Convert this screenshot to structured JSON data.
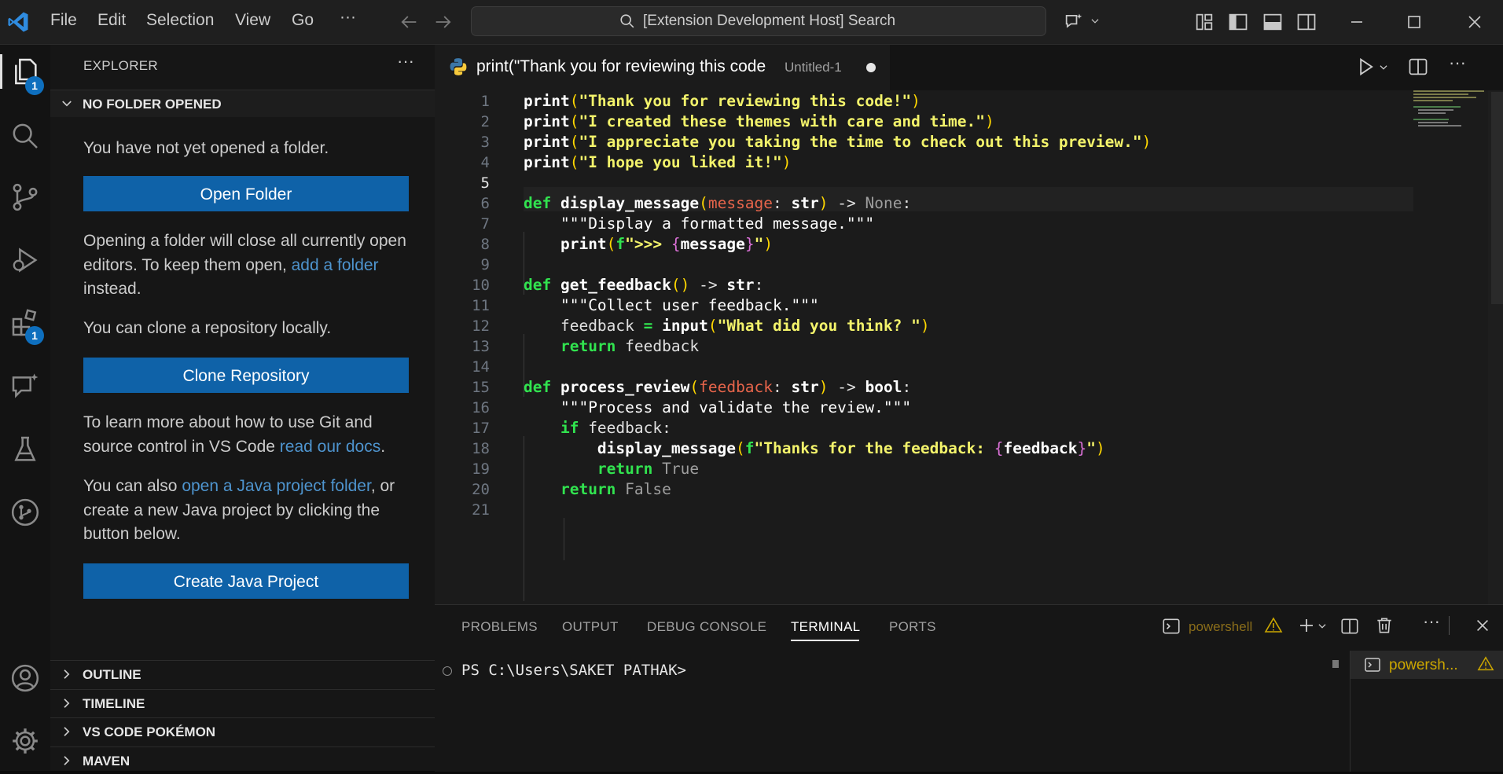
{
  "titlebar": {
    "menus": [
      "File",
      "Edit",
      "Selection",
      "View",
      "Go",
      "···"
    ],
    "search_text": "[Extension Development Host] Search"
  },
  "activity": {
    "explorer_badge": "1",
    "extensions_badge": "1"
  },
  "sidebar": {
    "title": "EXPLORER",
    "section": "NO FOLDER OPENED",
    "msg1": "You have not yet opened a folder.",
    "open_folder": "Open Folder",
    "msg2_a": "Opening a folder will close all currently open editors. To keep them open, ",
    "msg2_link": "add a folder",
    "msg2_b": " instead.",
    "msg3": "You can clone a repository locally.",
    "clone": "Clone Repository",
    "msg4_a": "To learn more about how to use Git and source control in VS Code ",
    "msg4_link": "read our docs",
    "msg4_b": ".",
    "msg5_a": "You can also ",
    "msg5_link": "open a Java project folder",
    "msg5_b": ", or create a new Java project by clicking the button below.",
    "create_java": "Create Java Project",
    "sections": [
      "OUTLINE",
      "TIMELINE",
      "VS CODE POKÉMON",
      "MAVEN"
    ]
  },
  "editor": {
    "tab_title": "print(\"Thank you for reviewing this code",
    "tab_file": "Untitled-1"
  },
  "code": {
    "line_numbers": [
      "1",
      "2",
      "3",
      "4",
      "5",
      "6",
      "7",
      "8",
      "9",
      "10",
      "11",
      "12",
      "13",
      "14",
      "15",
      "16",
      "17",
      "18",
      "19",
      "20",
      "21"
    ],
    "l1": "\"Thank you for reviewing this code!\"",
    "l2": "\"I created these themes with care and time.\"",
    "l3": "\"I appreciate you taking the time to check out this preview.\"",
    "l4": "\"I hope you liked it!\"",
    "l7": "\"\"\"Display a formatted message.\"\"\"",
    "l11": "\"\"\"Collect user feedback.\"\"\"",
    "l12": "\"What did you think? \"",
    "l16": "\"\"\"Process and validate the review.\"\"\"",
    "l18": "Thanks for the feedback: "
  },
  "panel": {
    "tabs": [
      "PROBLEMS",
      "OUTPUT",
      "DEBUG CONSOLE",
      "TERMINAL",
      "PORTS"
    ],
    "shell": "powershell",
    "prompt": "PS C:\\Users\\SAKET PATHAK>",
    "term_item": "powersh..."
  },
  "colors": {
    "accent": "#0f62a8",
    "badge": "#0e6fbe",
    "keyword": "#31e34f",
    "string": "#f3f36b",
    "param": "#e8654b",
    "warning": "#cca700"
  }
}
